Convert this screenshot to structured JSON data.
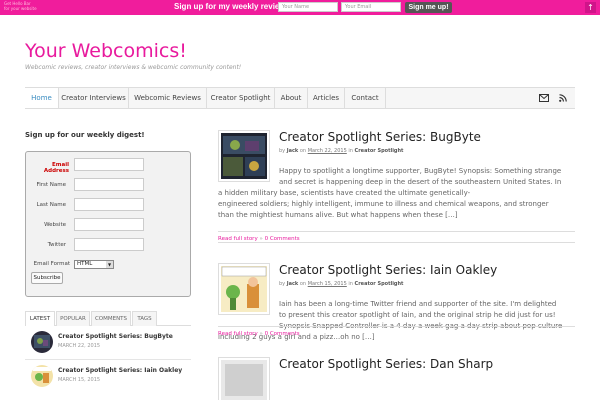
{
  "hellobar": {
    "brand_line1": "Get Hello Bar",
    "brand_line2": "for your website",
    "text": "Sign up for my weekly review digest!",
    "name_placeholder": "Your Name",
    "email_placeholder": "Your Email",
    "button": "Sign me up!",
    "arrow": "↑",
    "color": "#f01d9c"
  },
  "site": {
    "title": "Your Webcomics!",
    "description": "Webcomic reviews, creator interviews & webcomic community content!",
    "accent": "#e81a9d"
  },
  "nav": {
    "items": [
      "Home",
      "Creator Interviews",
      "Webcomic Reviews",
      "Creator Spotlight",
      "About",
      "Articles",
      "Contact"
    ],
    "icons": [
      "envelope-icon",
      "rss-icon"
    ]
  },
  "sidebar": {
    "digest_title": "Sign up for our weekly digest!",
    "form": {
      "email_label": "Email Address",
      "first_name_label": "First Name",
      "last_name_label": "Last Name",
      "website_label": "Website",
      "twitter_label": "Twitter",
      "email_format_label": "Email Format",
      "email_format_value": "HTML",
      "submit": "Subscribe"
    },
    "tabs": [
      "LATEST",
      "POPULAR",
      "COMMENTS",
      "TAGS"
    ],
    "posts": [
      {
        "title": "Creator Spotlight Series: BugByte",
        "date": "MARCH 22, 2015"
      },
      {
        "title": "Creator Spotlight Series: Iain Oakley",
        "date": "MARCH 15, 2015"
      }
    ]
  },
  "posts": [
    {
      "title": "Creator Spotlight Series: BugByte",
      "by": "by",
      "author": "Jack",
      "on": "on",
      "date": "March 22, 2015",
      "in": "in",
      "category": "Creator Spotlight",
      "excerpt": [
        "Happy to spotlight a longtime supporter, BugByte! Synopsis: Something strange",
        "and secret is happening deep in the desert of the southeastern United States. In",
        "a hidden military base, scientists have created the ultimate genetically-",
        "engineered soldiers; highly intelligent, immune to illness and chemical weapons, and stronger",
        "than the mightiest humans alive. But what happens when these […]"
      ],
      "read_more": "Read full story",
      "sep": "»",
      "comments": "0 Comments"
    },
    {
      "title": "Creator Spotlight Series: Iain Oakley",
      "by": "by",
      "author": "Jack",
      "on": "on",
      "date": "March 15, 2015",
      "in": "in",
      "category": "Creator Spotlight",
      "excerpt": [
        "Iain has been a long-time Twitter friend and supporter of the site. I'm delighted",
        "to present this creator spotlight of Iain, and the original strip he did just for us!",
        "Synopsis Snapped Controller is a 4 day a week gag a day strip about pop culture",
        "including 2 guys a girl and a pizz…oh no […]"
      ],
      "read_more": "Read full story",
      "sep": "»",
      "comments": "0 Comments"
    },
    {
      "title": "Creator Spotlight Series: Dan Sharp"
    }
  ]
}
